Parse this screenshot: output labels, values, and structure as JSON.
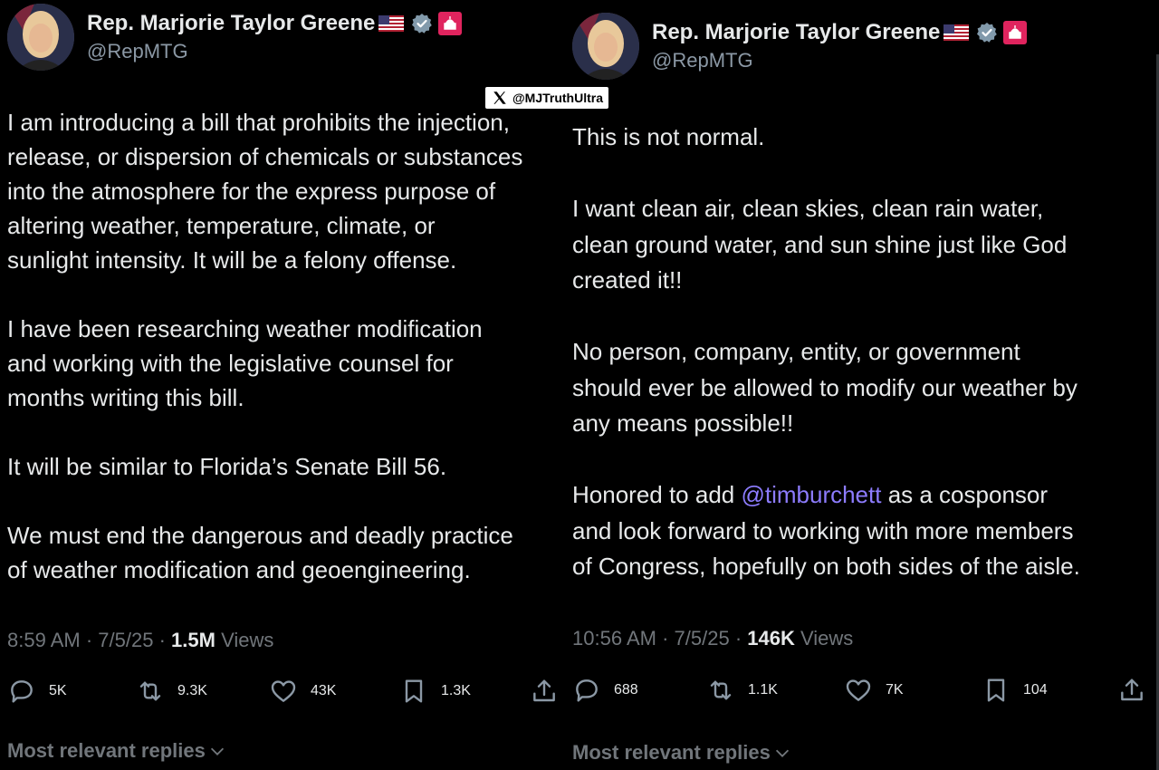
{
  "left_tweet": {
    "author_name": "Rep. Marjorie Taylor Greene",
    "handle": "@RepMTG",
    "body": "I am introducing a bill that prohibits the injection,\nrelease, or dispersion of chemicals or substances\ninto the atmosphere for the express purpose of\naltering weather, temperature, climate, or\nsunlight intensity. It will be a felony offense.\n\nI have been researching weather modification\nand working with the legislative counsel for\nmonths writing this bill.\n\nIt will be similar to Florida’s Senate Bill 56.\n\nWe must end the dangerous and deadly practice\nof weather modification and geoengineering.",
    "time": "8:59 AM",
    "date": "7/5/25",
    "views_count": "1.5M",
    "views_label": "Views",
    "replies": "5K",
    "reposts": "9.3K",
    "likes": "43K",
    "bookmarks": "1.3K",
    "most_relevant": "Most relevant replies"
  },
  "right_tweet": {
    "author_name": "Rep. Marjorie Taylor Greene",
    "handle": "@RepMTG",
    "body_part1": "This is not normal.\n\nI want clean air, clean skies, clean rain water,\nclean ground water, and sun shine just like God\ncreated it!!\n\nNo person, company, entity, or government\nshould ever be allowed to modify our weather by\nany means possible!!\n\nHonored to add ",
    "mention": "@timburchett",
    "body_part2": " as a cosponsor\nand look forward to working with more members\nof Congress, hopefully on both sides of the aisle.",
    "time": "10:56 AM",
    "date": "7/5/25",
    "views_count": "146K",
    "views_label": "Views",
    "replies": "688",
    "reposts": "1.1K",
    "likes": "7K",
    "bookmarks": "104",
    "most_relevant": "Most relevant replies"
  },
  "watermark": {
    "handle": "@MJTruthUltra"
  },
  "colors": {
    "background": "#000000",
    "text": "#e7e9ea",
    "muted": "#71767b",
    "mention": "#8d7cff",
    "verified": "#829aab",
    "badge": "#e0245e"
  },
  "icons": [
    "reply-icon",
    "repost-icon",
    "like-icon",
    "bookmark-icon",
    "share-icon",
    "verified-icon",
    "flag-icon",
    "capitol-badge-icon",
    "chevron-down-icon",
    "x-logo-icon"
  ]
}
